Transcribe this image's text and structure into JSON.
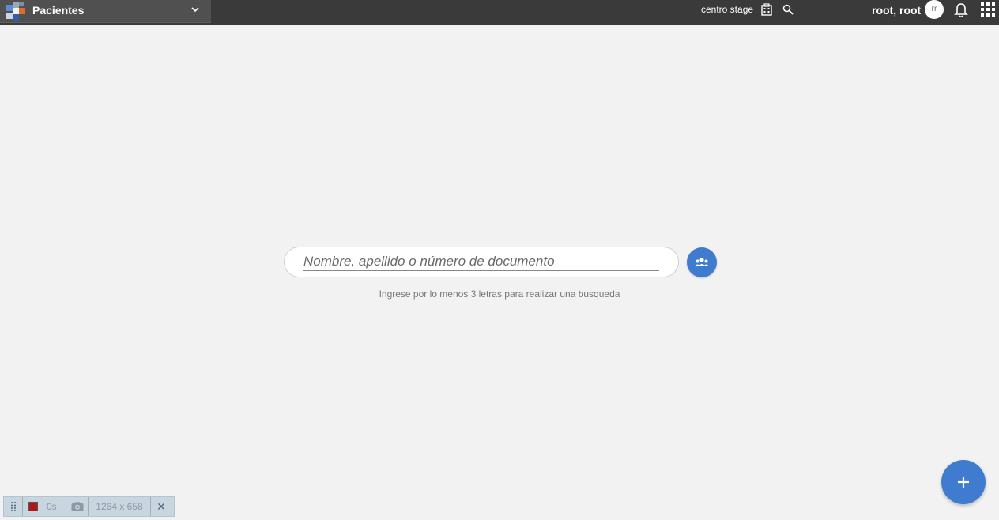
{
  "header": {
    "module": "Pacientes",
    "center": "centro stage",
    "user": "root, root",
    "avatar_initials": "rr"
  },
  "search": {
    "placeholder": "Nombre, apellido o número de documento",
    "value": "",
    "hint": "Ingrese por lo menos 3 letras para realizar una busqueda"
  },
  "debug_toolbar": {
    "timer": "0s",
    "viewport": "1264 x 658"
  },
  "colors": {
    "topbar": "#3a3a3a",
    "accent": "#3f7ccf",
    "background": "#f2f2f2"
  },
  "icons": [
    "app-logo-icon",
    "chevron-down-icon",
    "building-icon",
    "search-icon",
    "bell-icon",
    "apps-grid-icon",
    "group-icon",
    "plus-icon",
    "drag-handle-icon",
    "record-icon",
    "camera-icon",
    "close-icon"
  ]
}
